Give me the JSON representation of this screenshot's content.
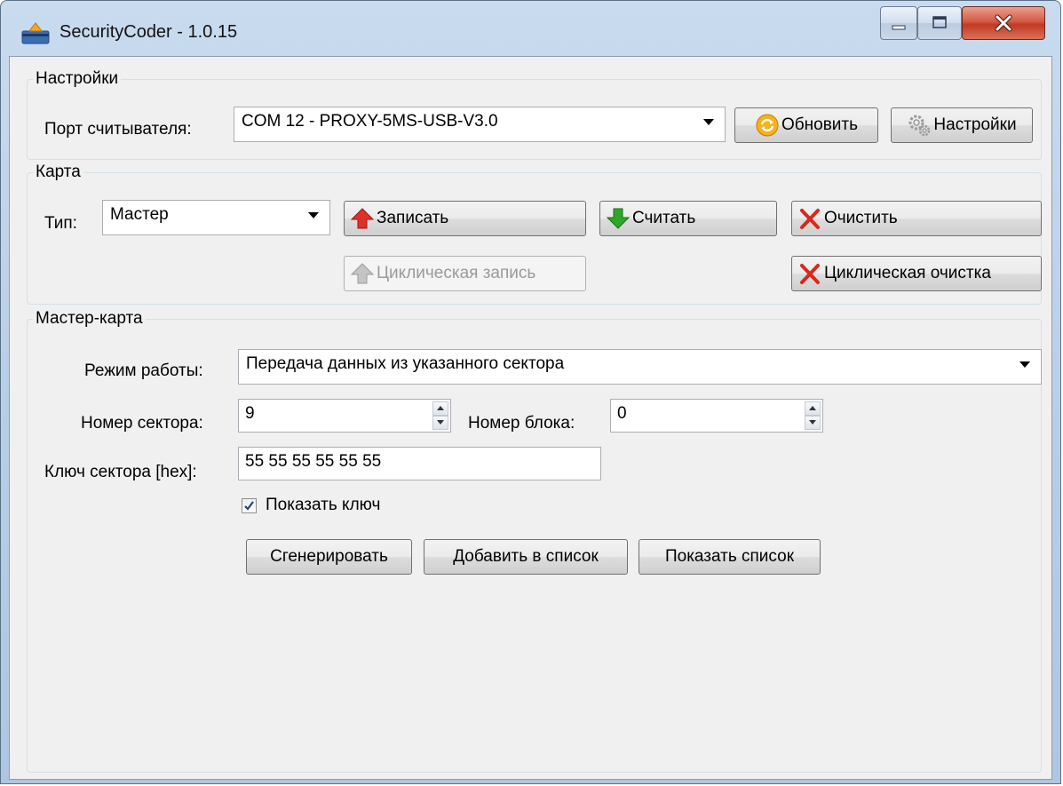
{
  "window": {
    "title": "SecurityCoder - 1.0.15"
  },
  "settings_group": {
    "legend": "Настройки",
    "port_label": "Порт считывателя:",
    "port_value": "COM 12 - PROXY-5MS-USB-V3.0",
    "refresh_label": "Обновить",
    "settings_label": "Настройки"
  },
  "card_group": {
    "legend": "Карта",
    "type_label": "Тип:",
    "type_value": "Мастер",
    "write_label": "Записать",
    "read_label": "Считать",
    "clear_label": "Очистить",
    "cyclic_write_label": "Циклическая запись",
    "cyclic_clear_label": "Циклическая очистка"
  },
  "master_group": {
    "legend": "Мастер-карта",
    "mode_label": "Режим работы:",
    "mode_value": "Передача данных из указанного сектора",
    "sector_label": "Номер сектора:",
    "sector_value": "9",
    "block_label": "Номер блока:",
    "block_value": "0",
    "key_label": "Ключ сектора [hex]:",
    "key_value": "55 55 55 55 55 55",
    "show_key_label": "Показать ключ",
    "show_key_checked": true,
    "generate_label": "Сгенерировать",
    "add_to_list_label": "Добавить в список",
    "show_list_label": "Показать список"
  },
  "colors": {
    "titlebar": "#c9dbee",
    "client_bg": "#f0f0f0",
    "close_button": "#c23a22",
    "write_arrow": "#e0302a",
    "read_arrow": "#2fa82a",
    "clear_x": "#d9281c"
  }
}
